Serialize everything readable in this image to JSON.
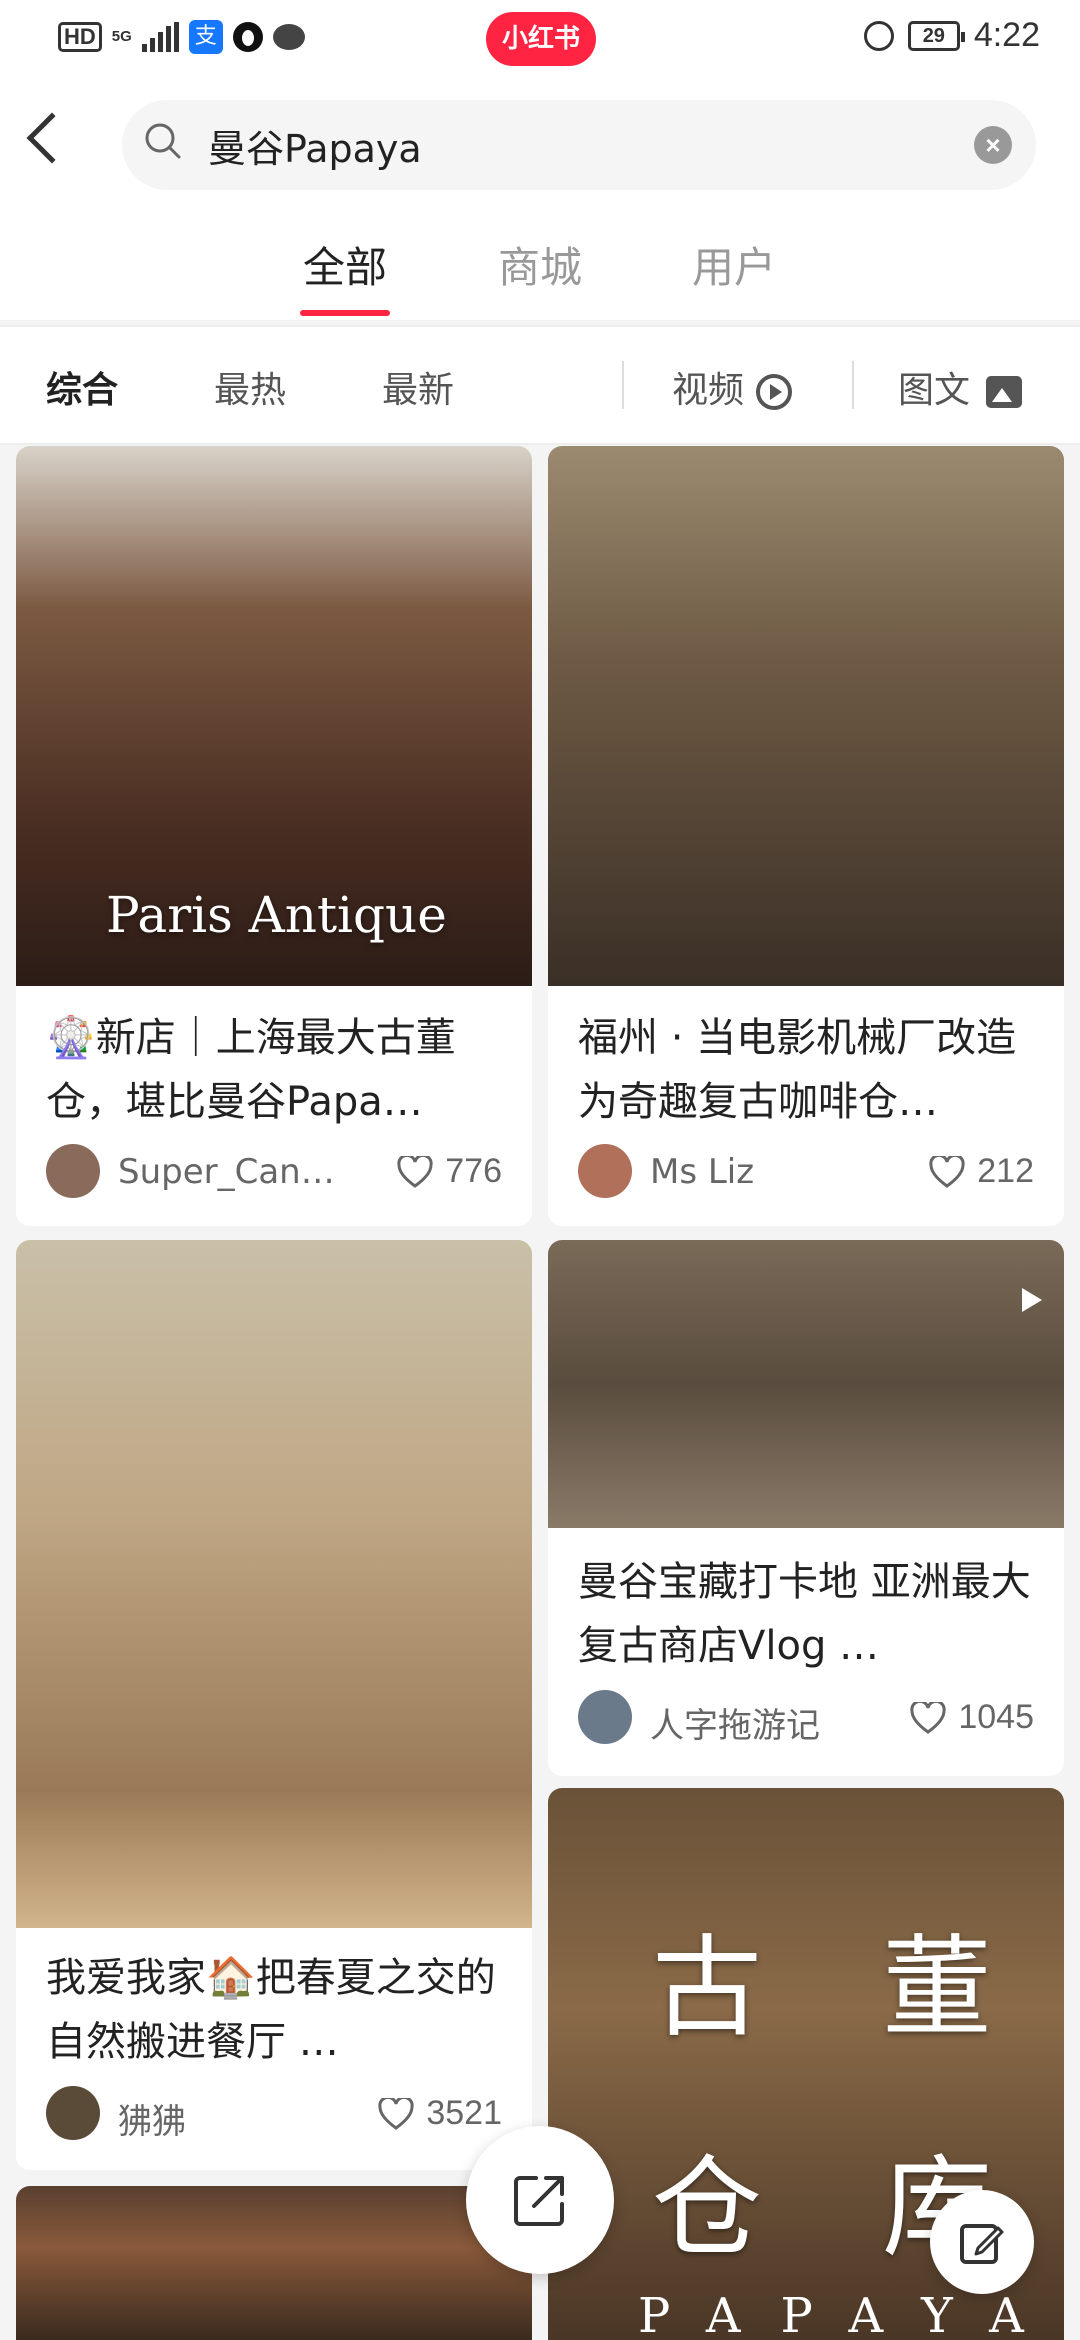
{
  "status_bar": {
    "hd": "HD",
    "network": "5G",
    "app_logo": "小红书",
    "battery": "29",
    "time": "4:22",
    "icons": [
      "alipay-icon",
      "penguin-icon",
      "chat-icon",
      "alarm-icon",
      "battery-icon",
      "signal-icon"
    ]
  },
  "search": {
    "query": "曼谷Papaya"
  },
  "tabs": [
    {
      "label": "全部",
      "active": true
    },
    {
      "label": "商城",
      "active": false
    },
    {
      "label": "用户",
      "active": false
    }
  ],
  "filters": {
    "sort": [
      {
        "label": "综合",
        "active": true
      },
      {
        "label": "最热",
        "active": false
      },
      {
        "label": "最新",
        "active": false
      }
    ],
    "video": "视频",
    "image_text": "图文"
  },
  "cards": [
    {
      "overlay": "Paris  Antique",
      "title": "🎡新店｜上海最大古董仓，堪比曼谷Papa…",
      "author": "Super_Can…",
      "likes": "776"
    },
    {
      "title": "福州 · 当电影机械厂改造为奇趣复古咖啡仓…",
      "author": "Ms Liz",
      "likes": "212"
    },
    {
      "title": "我爱我家🏠把春夏之交的自然搬进餐厅 …",
      "author": "狒狒",
      "likes": "3521"
    },
    {
      "title": "曼谷宝藏打卡地 亚洲最大复古商店Vlog …",
      "author": "人字拖游记",
      "likes": "1045"
    },
    {
      "overlay_chars": [
        "古",
        "董",
        "仓",
        "库"
      ],
      "brand": "PAPAYA"
    }
  ],
  "colors": {
    "accent": "#ff2442",
    "text_primary": "#222222",
    "text_secondary": "#666666"
  }
}
